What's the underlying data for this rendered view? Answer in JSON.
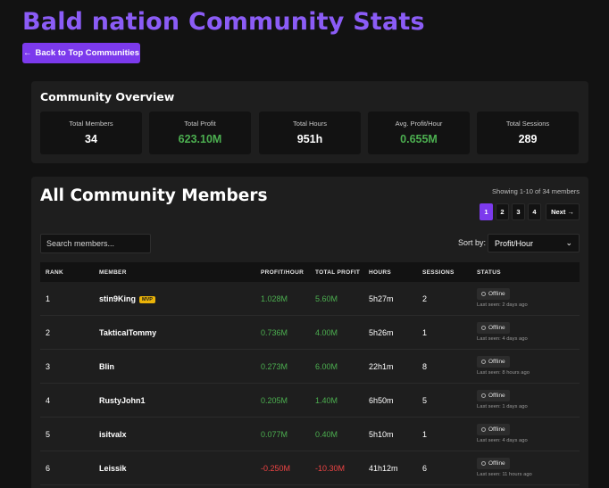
{
  "header": {
    "title": "Bald nation Community Stats",
    "back_label": "Back to Top Communities"
  },
  "overview": {
    "title": "Community Overview",
    "stats": [
      {
        "label": "Total Members",
        "value": "34"
      },
      {
        "label": "Total Profit",
        "value": "623.10M"
      },
      {
        "label": "Total Hours",
        "value": "951h"
      },
      {
        "label": "Avg. Profit/Hour",
        "value": "0.655M"
      },
      {
        "label": "Total Sessions",
        "value": "289"
      }
    ]
  },
  "members": {
    "title": "All Community Members",
    "showing": "Showing 1-10 of 34 members",
    "pages": [
      "1",
      "2",
      "3",
      "4"
    ],
    "next_label": "Next",
    "search_placeholder": "Search members...",
    "sort_label": "Sort by:",
    "sort_value": "Profit/Hour",
    "columns": [
      "RANK",
      "MEMBER",
      "PROFIT/HOUR",
      "TOTAL PROFIT",
      "HOURS",
      "SESSIONS",
      "STATUS"
    ],
    "rows": [
      {
        "rank": "1",
        "member": "stin9King",
        "badge": "MVP",
        "profit_hour": "1.028M",
        "total_profit": "5.60M",
        "hours": "5h27m",
        "sessions": "2",
        "status": "Offline",
        "last_seen": "Last seen: 2 days ago"
      },
      {
        "rank": "2",
        "member": "TakticalTommy",
        "profit_hour": "0.736M",
        "total_profit": "4.00M",
        "hours": "5h26m",
        "sessions": "1",
        "status": "Offline",
        "last_seen": "Last seen: 4 days ago"
      },
      {
        "rank": "3",
        "member": "Blin",
        "profit_hour": "0.273M",
        "total_profit": "6.00M",
        "hours": "22h1m",
        "sessions": "8",
        "status": "Offline",
        "last_seen": "Last seen: 8 hours ago"
      },
      {
        "rank": "4",
        "member": "RustyJohn1",
        "profit_hour": "0.205M",
        "total_profit": "1.40M",
        "hours": "6h50m",
        "sessions": "5",
        "status": "Offline",
        "last_seen": "Last seen: 1 days ago"
      },
      {
        "rank": "5",
        "member": "isitvalx",
        "profit_hour": "0.077M",
        "total_profit": "0.40M",
        "hours": "5h10m",
        "sessions": "1",
        "status": "Offline",
        "last_seen": "Last seen: 4 days ago"
      },
      {
        "rank": "6",
        "member": "Leissik",
        "profit_hour": "-0.250M",
        "total_profit": "-10.30M",
        "hours": "41h12m",
        "sessions": "6",
        "status": "Offline",
        "last_seen": "Last seen: 11 hours ago"
      }
    ]
  },
  "colors": {
    "accent": "#7c3aed",
    "title": "#8b5cf6",
    "positive": "#4caf50",
    "negative": "#ef4444",
    "mvp": "#eab308"
  }
}
